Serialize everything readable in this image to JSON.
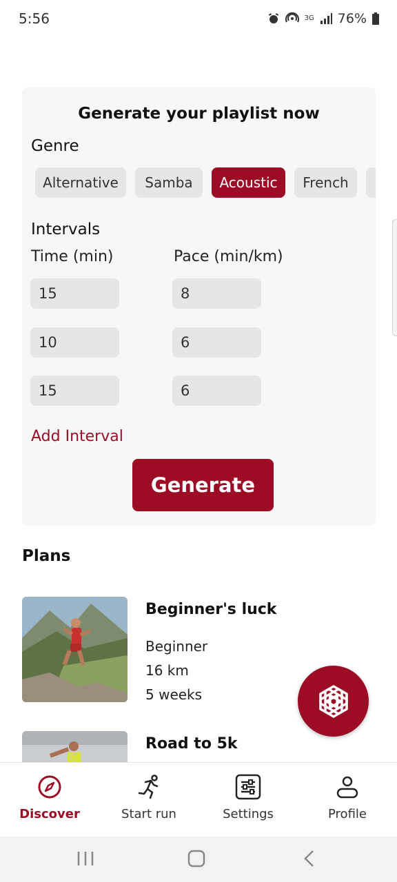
{
  "status_bar": {
    "time": "5:56",
    "battery": "76%",
    "network": "3G"
  },
  "card": {
    "title": "Generate your playlist now",
    "genre_label": "Genre",
    "genres": [
      "Alternative",
      "Samba",
      "Acoustic",
      "French"
    ],
    "selected_genre": "Acoustic",
    "intervals_label": "Intervals",
    "time_column": "Time (min)",
    "pace_column": "Pace (min/km)",
    "intervals": [
      {
        "time": "15",
        "pace": "8"
      },
      {
        "time": "10",
        "pace": "6"
      },
      {
        "time": "15",
        "pace": "6"
      }
    ],
    "add_interval": "Add Interval",
    "generate": "Generate"
  },
  "plans": {
    "heading": "Plans",
    "items": [
      {
        "title": "Beginner's luck",
        "level": "Beginner",
        "distance": "16 km",
        "duration": "5 weeks"
      },
      {
        "title": "Road to 5k"
      }
    ]
  },
  "fab": {
    "icon": "openai-logo-icon"
  },
  "bottom_nav": {
    "items": [
      {
        "label": "Discover",
        "icon": "compass-icon",
        "active": true
      },
      {
        "label": "Start run",
        "icon": "runner-icon",
        "active": false
      },
      {
        "label": "Settings",
        "icon": "sliders-icon",
        "active": false
      },
      {
        "label": "Profile",
        "icon": "person-icon",
        "active": false
      }
    ]
  },
  "colors": {
    "accent": "#9c0c25",
    "chip_bg": "#e6e6e6",
    "card_bg": "#f7f7f7"
  }
}
